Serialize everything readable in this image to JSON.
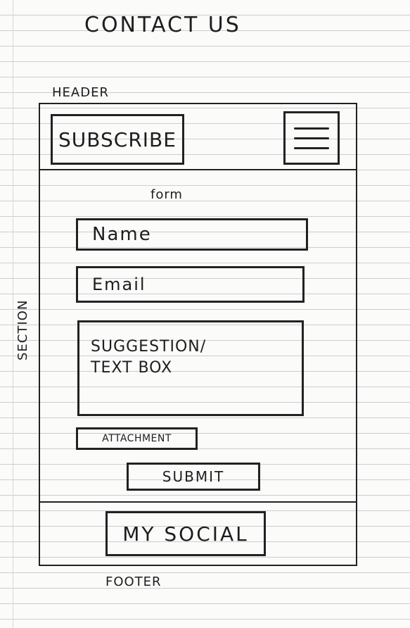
{
  "page": {
    "title": "CONTACT US"
  },
  "labels": {
    "header": "HEADER",
    "section": "SECTION",
    "footer": "FOOTER",
    "form": "form"
  },
  "header": {
    "subscribe_label": "SUBSCRIBE",
    "menu_icon": "hamburger-menu-icon"
  },
  "form": {
    "name_placeholder": "Name",
    "email_placeholder": "Email",
    "suggestion_text": "SUGGESTION/\nTEXT BOX",
    "attachment_label": "ATTACHMENT",
    "submit_label": "SUBMIT"
  },
  "footer": {
    "social_label": "MY SOCIAL"
  }
}
